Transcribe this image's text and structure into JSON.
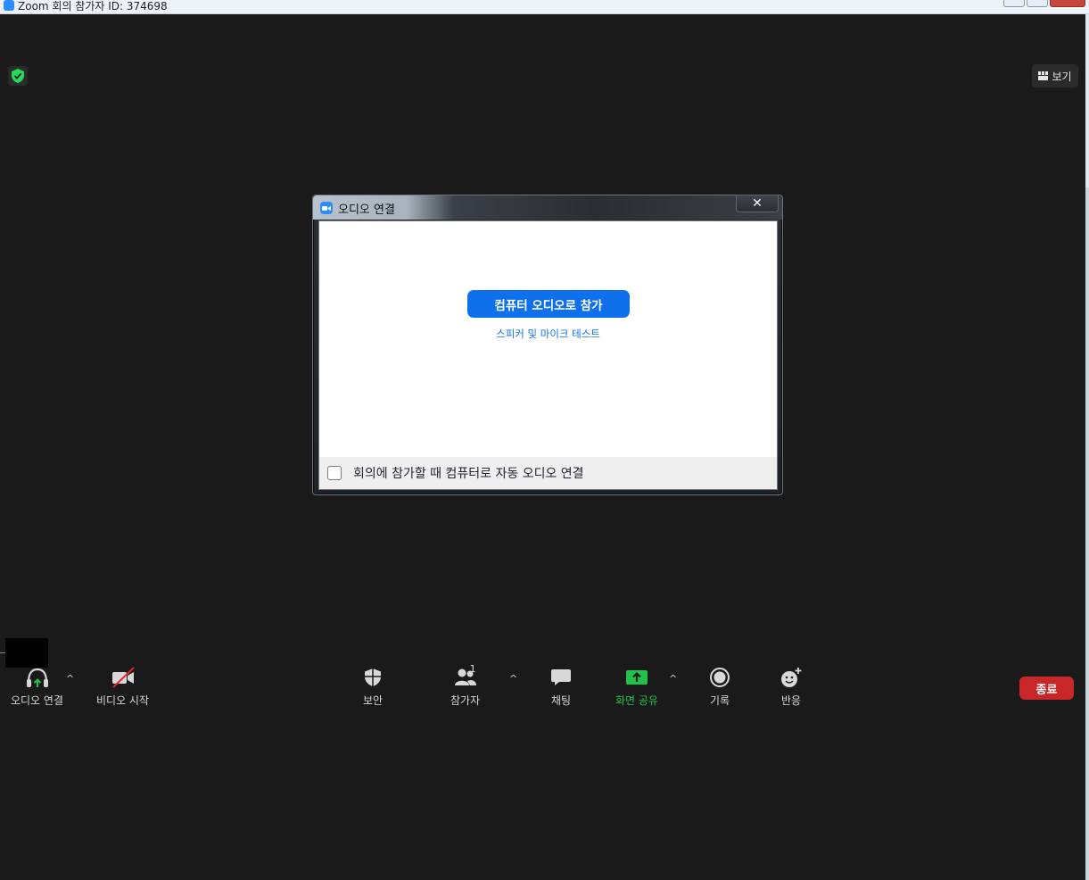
{
  "window": {
    "title": "Zoom 회의 참가자 ID: 374698",
    "app_icon": "zoom-icon"
  },
  "main": {
    "view_button_label": "보기",
    "shield_icon": "shield-check-icon"
  },
  "dialog": {
    "title": "오디오 연결",
    "close_glyph": "✕",
    "join_button_label": "컴퓨터 오디오로 참가",
    "test_link_label": "스피커 및 마이크 테스트",
    "auto_join_checkbox_label": "회의에 참가할 때 컴퓨터로 자동 오디오 연결",
    "auto_join_checked": false
  },
  "toolbar": {
    "audio_label": "오디오 연결",
    "video_label": "비디오 시작",
    "security_label": "보안",
    "participants_label": "참가자",
    "participants_count": "1",
    "chat_label": "채팅",
    "share_label": "화면 공유",
    "record_label": "기록",
    "reactions_label": "반응",
    "end_label": "종료"
  },
  "colors": {
    "background": "#1a1a1a",
    "accent_blue": "#0e71eb",
    "share_green": "#20c24b",
    "end_red": "#c82729"
  }
}
